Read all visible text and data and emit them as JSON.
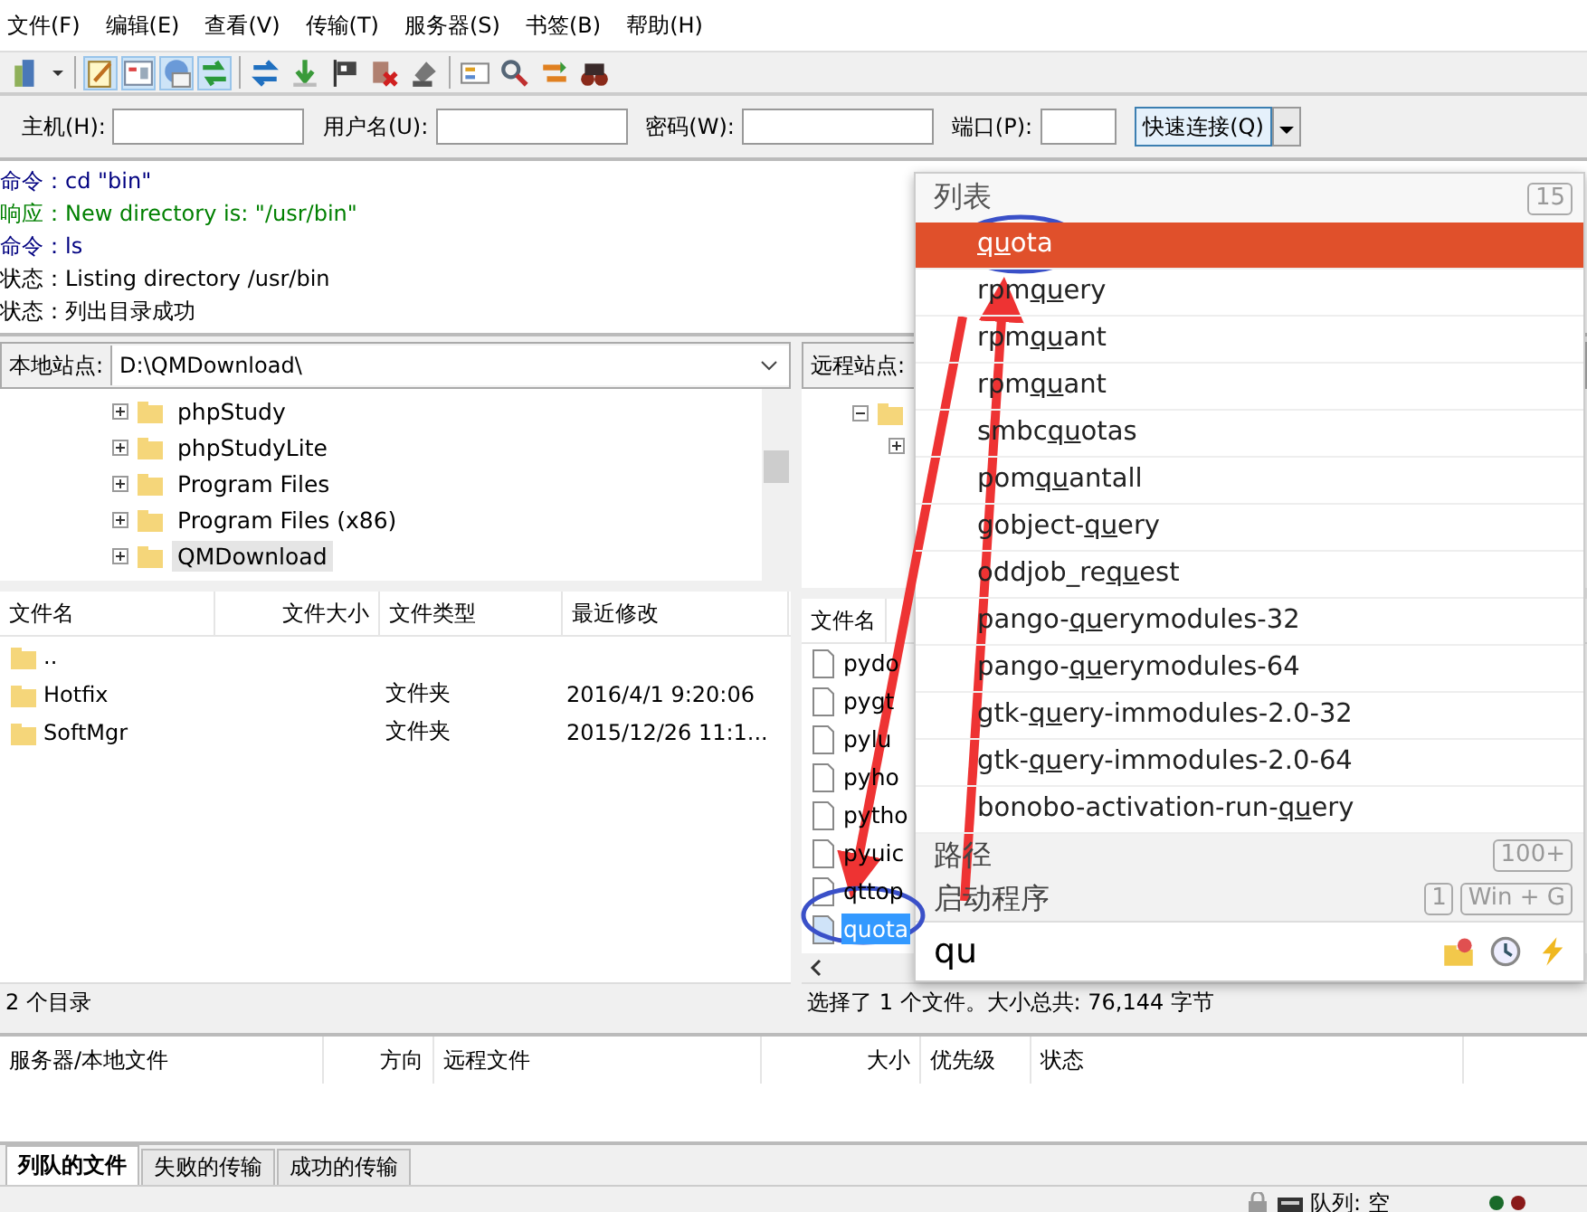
{
  "menu": [
    "文件(F)",
    "编辑(E)",
    "查看(V)",
    "传输(T)",
    "服务器(S)",
    "书签(B)",
    "帮助(H)"
  ],
  "quickconnect": {
    "fields": [
      {
        "label": "主机(H):"
      },
      {
        "label": "用户名(U):"
      },
      {
        "label": "密码(W):"
      },
      {
        "label": "端口(P):"
      }
    ],
    "button": "快速连接(Q)"
  },
  "log": [
    {
      "kind": "command",
      "prefix": "命令：",
      "text": "cd \"bin\""
    },
    {
      "kind": "response",
      "prefix": "响应：",
      "text": "New directory is: \"/usr/bin\""
    },
    {
      "kind": "command",
      "prefix": "命令：",
      "text": "ls"
    },
    {
      "kind": "status",
      "prefix": "状态：",
      "text": "Listing directory /usr/bin"
    },
    {
      "kind": "status",
      "prefix": "状态：",
      "text": "列出目录成功"
    }
  ],
  "local": {
    "site_label": "本地站点:",
    "path": "D:\\QMDownload\\",
    "tree": [
      {
        "name": "phpStudy",
        "selected": false
      },
      {
        "name": "phpStudyLite",
        "selected": false
      },
      {
        "name": "Program Files",
        "selected": false
      },
      {
        "name": "Program Files (x86)",
        "selected": false
      },
      {
        "name": "QMDownload",
        "selected": true
      }
    ],
    "columns": [
      "文件名",
      "文件大小",
      "文件类型",
      "最近修改"
    ],
    "rows": [
      {
        "name": ".."
      },
      {
        "name": "Hotfix",
        "type": "文件夹",
        "modified": "2016/4/1 9:20:06"
      },
      {
        "name": "SoftMgr",
        "type": "文件夹",
        "modified": "2015/12/26 11:1..."
      }
    ],
    "status": "2 个目录"
  },
  "remote": {
    "site_label": "远程站点:",
    "columns": [
      "文件名"
    ],
    "files": [
      {
        "name": "pydo",
        "selected": false
      },
      {
        "name": "pygt",
        "selected": false
      },
      {
        "name": "pylu",
        "selected": false
      },
      {
        "name": "pyho",
        "selected": false
      },
      {
        "name": "pytho",
        "selected": false
      },
      {
        "name": "pyuic",
        "selected": false
      },
      {
        "name": "qttop",
        "selected": false
      },
      {
        "name": "quota",
        "selected": true
      }
    ],
    "status": "选择了 1 个文件。大小总共: 76,144 字节"
  },
  "queue": {
    "columns": [
      "服务器/本地文件",
      "方向",
      "远程文件",
      "大小",
      "优先级",
      "状态"
    ],
    "tabs": [
      {
        "label": "列队的文件",
        "selected": true
      },
      {
        "label": "失败的传输",
        "selected": false
      },
      {
        "label": "成功的传输",
        "selected": false
      }
    ]
  },
  "status_bar": {
    "queue": "队列: 空"
  },
  "popup": {
    "title": "列表",
    "count": "15",
    "items": [
      {
        "match": "qu",
        "after": "ota",
        "selected": true
      },
      {
        "before": "rpm",
        "match": "qu",
        "after": "ery",
        "selected": false
      },
      {
        "before": "rpm",
        "match": "qu",
        "after": "ant",
        "selected": false
      },
      {
        "before": "rpm",
        "match": "qu",
        "after": "ant",
        "selected": false
      },
      {
        "before": "smbc",
        "match": "qu",
        "after": "otas",
        "selected": false
      },
      {
        "before": "pom",
        "match": "qu",
        "after": "antall",
        "selected": false
      },
      {
        "before": "gobject-",
        "match": "qu",
        "after": "ery",
        "selected": false
      },
      {
        "before": "oddjob_re",
        "match": "qu",
        "after": "est",
        "selected": false
      },
      {
        "before": "pango-",
        "match": "qu",
        "after": "erymodules-32",
        "selected": false
      },
      {
        "before": "pango-",
        "match": "qu",
        "after": "erymodules-64",
        "selected": false
      },
      {
        "before": "gtk-",
        "match": "qu",
        "after": "ery-immodules-2.0-32",
        "selected": false
      },
      {
        "before": "gtk-",
        "match": "qu",
        "after": "ery-immodules-2.0-64",
        "selected": false
      },
      {
        "before": "bonobo-activation-run-",
        "match": "qu",
        "after": "ery",
        "selected": false
      }
    ],
    "sections": [
      {
        "label": "路径",
        "badges": [
          "100+"
        ]
      },
      {
        "label": "启动程序",
        "badges": [
          "1",
          "Win + G"
        ]
      }
    ],
    "query": "qu"
  }
}
